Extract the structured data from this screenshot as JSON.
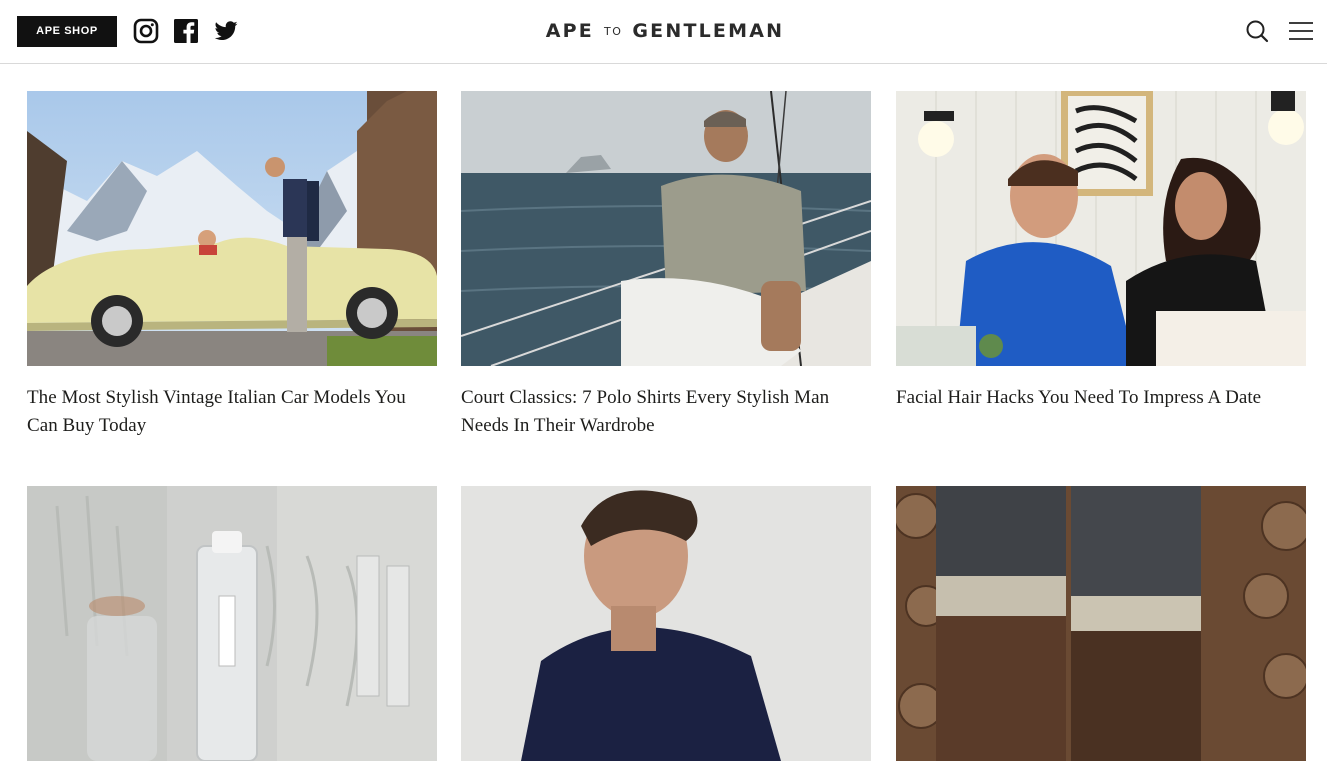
{
  "header": {
    "shop_label": "APE SHOP",
    "logo": {
      "left": "APE",
      "mid": "TO",
      "right": "GENTLEMAN"
    },
    "icons": [
      "instagram-icon",
      "facebook-icon",
      "twitter-icon",
      "search-icon",
      "menu-icon"
    ]
  },
  "articles": [
    {
      "title": "The Most Stylish Vintage Italian Car Models You Can Buy Today",
      "image": "vintage-car-photo"
    },
    {
      "title": "Court Classics: 7 Polo Shirts Every Stylish Man Needs In Their Wardrobe",
      "image": "polo-sea-photo"
    },
    {
      "title": "Facial Hair Hacks You Need To Impress A Date",
      "image": "date-couple-photo"
    },
    {
      "title": "",
      "image": "glassware-photo"
    },
    {
      "title": "",
      "image": "portrait-photo"
    },
    {
      "title": "",
      "image": "denim-cuffs-photo"
    }
  ],
  "colors": {
    "header_bg": "#ffffff",
    "shop_btn": "#111111",
    "text": "#1d1d1b",
    "divider": "#d9d9d9"
  }
}
